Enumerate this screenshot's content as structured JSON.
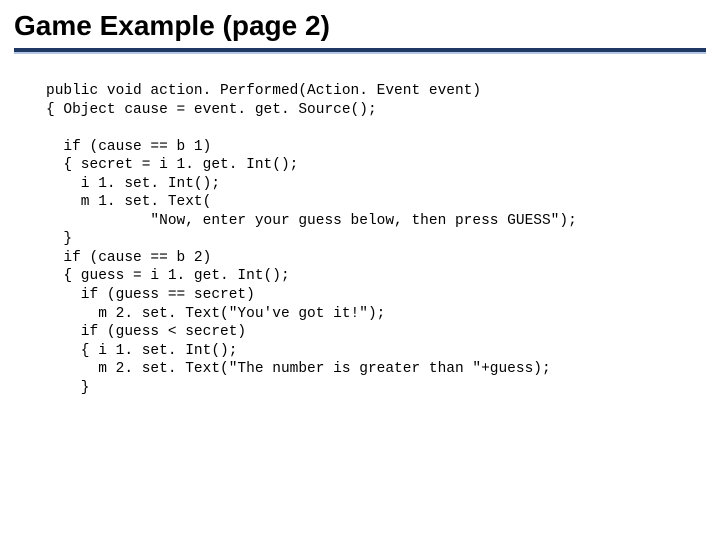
{
  "slide": {
    "title": "Game Example (page 2)",
    "code": "public void action. Performed(Action. Event event)\n{ Object cause = event. get. Source();\n\n  if (cause == b 1)\n  { secret = i 1. get. Int();\n    i 1. set. Int();\n    m 1. set. Text(\n            \"Now, enter your guess below, then press GUESS\");\n  }\n  if (cause == b 2)\n  { guess = i 1. get. Int();\n    if (guess == secret)\n      m 2. set. Text(\"You've got it!\");\n    if (guess < secret)\n    { i 1. set. Int();\n      m 2. set. Text(\"The number is greater than \"+guess);\n    }"
  }
}
